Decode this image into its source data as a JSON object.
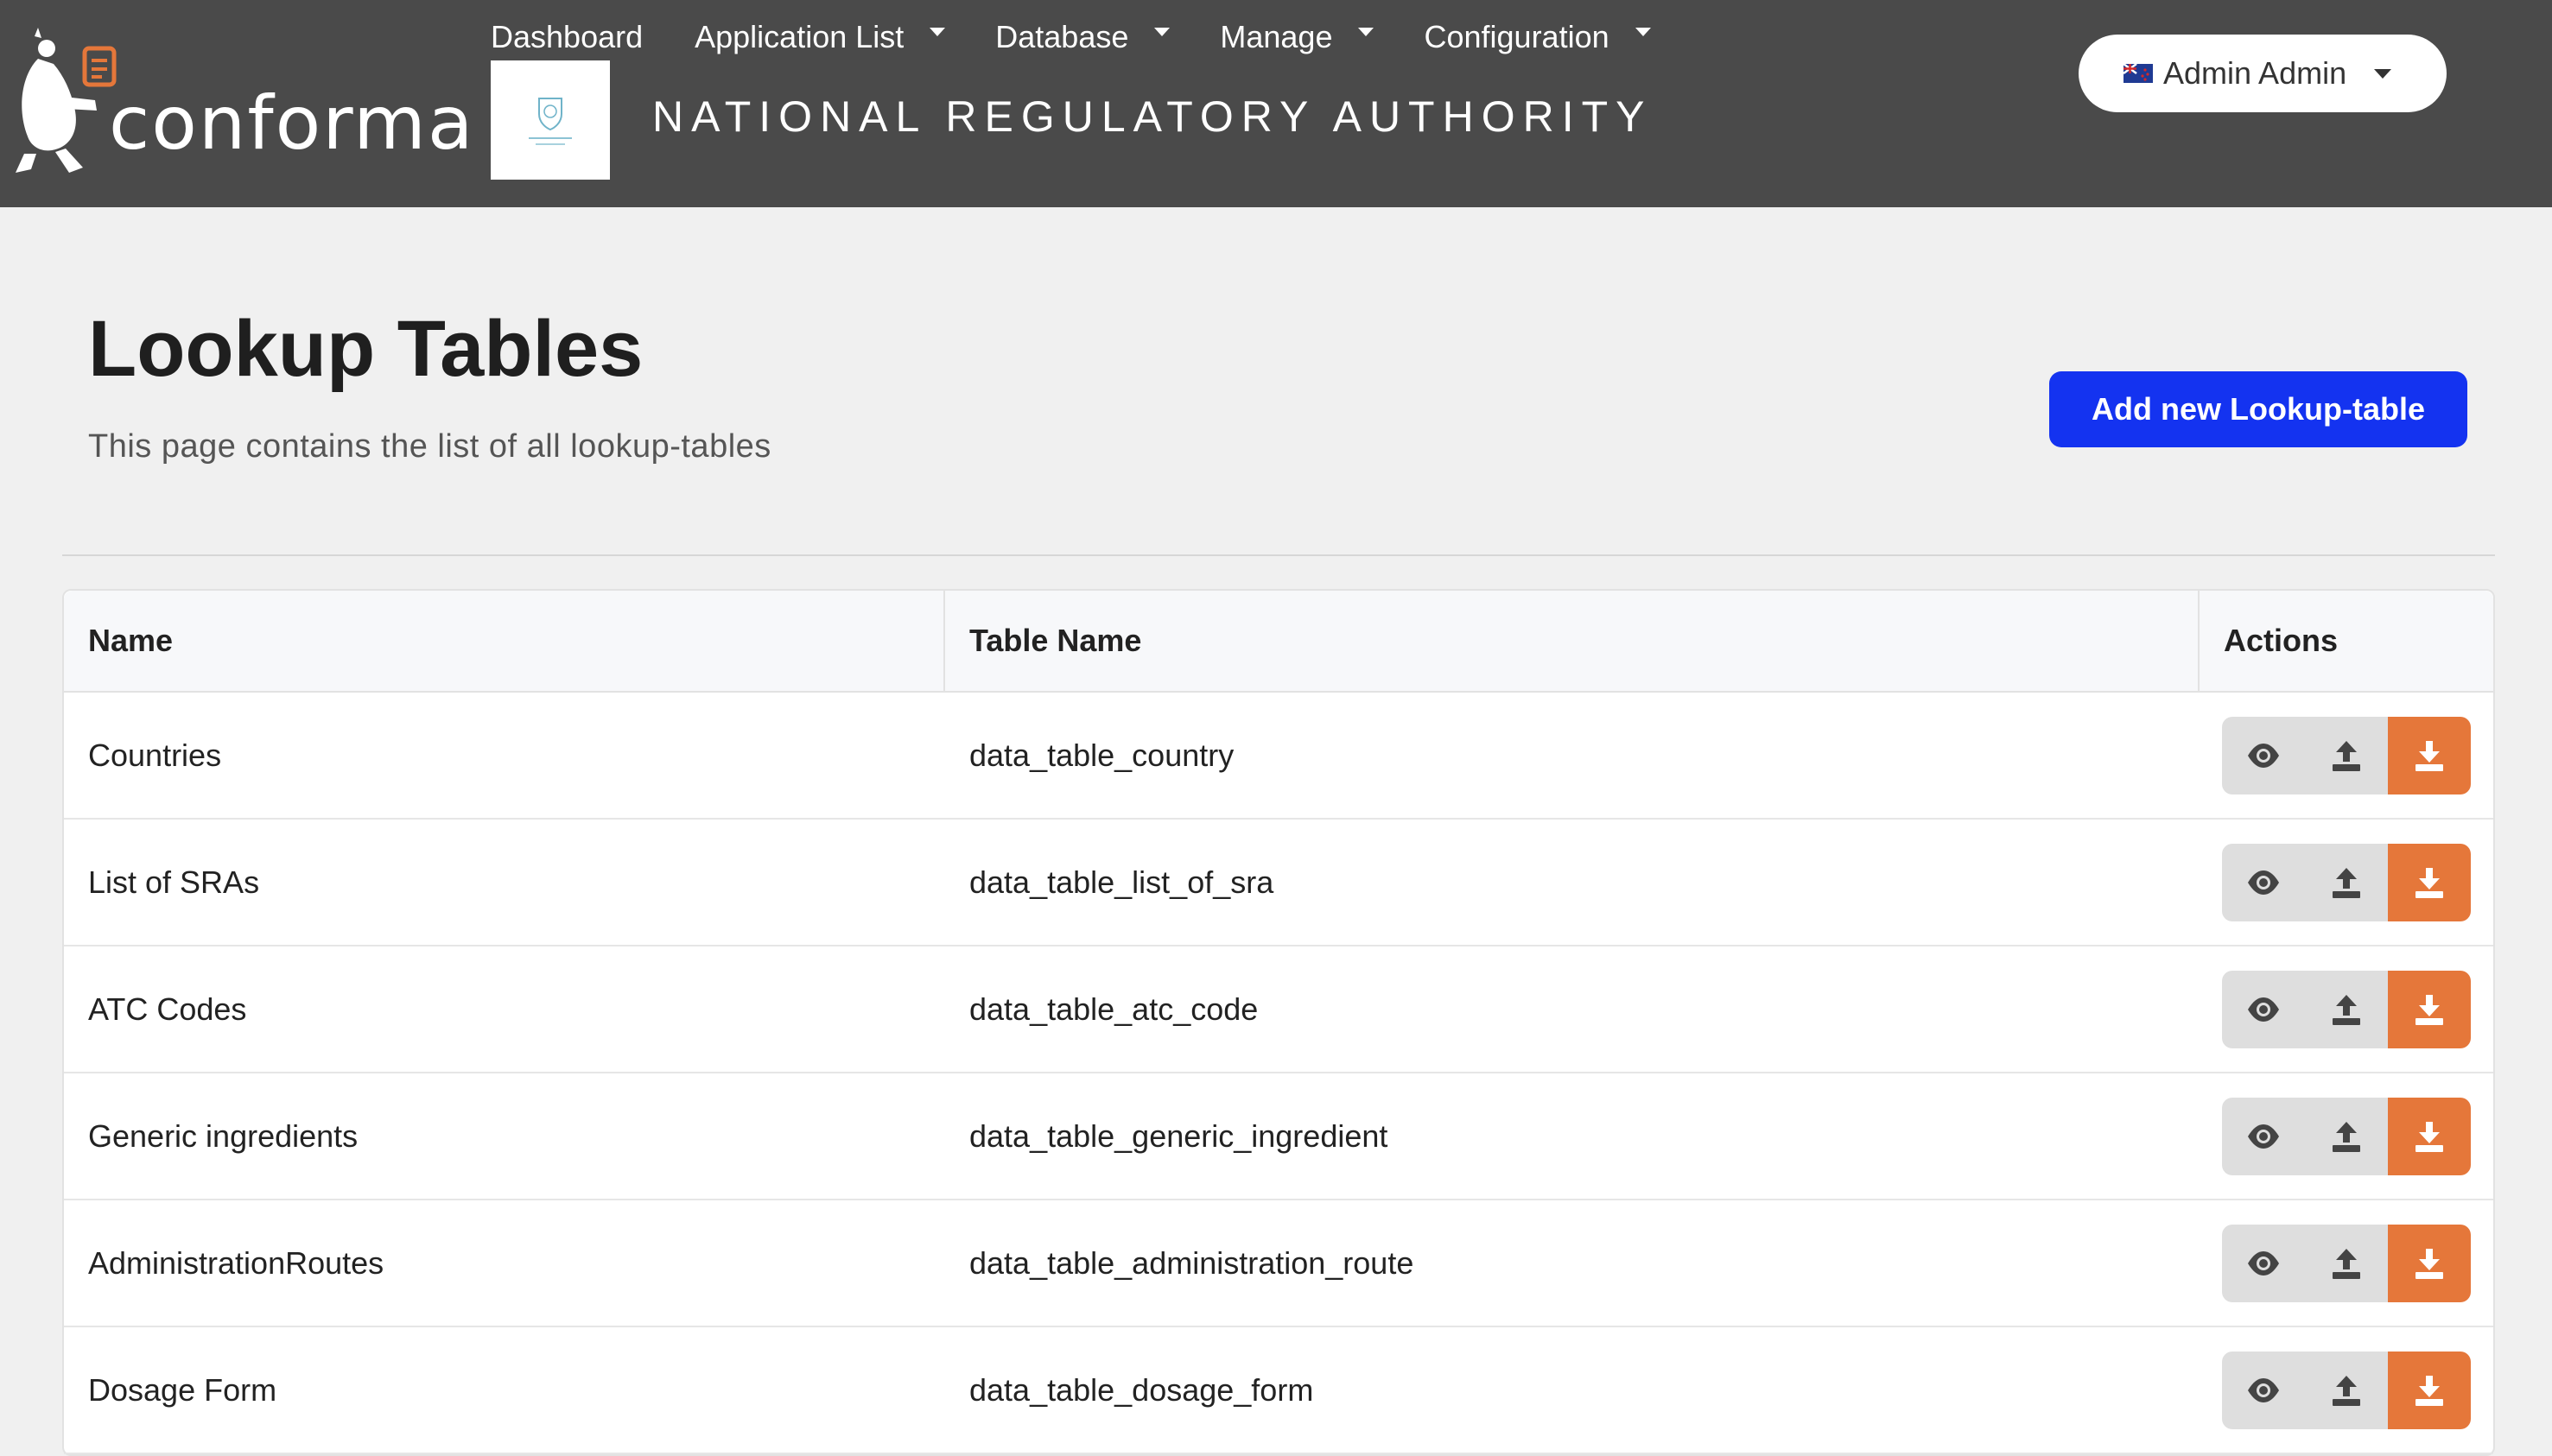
{
  "brand": {
    "app_name": "conforma",
    "org_name": "NATIONAL REGULATORY AUTHORITY"
  },
  "nav": {
    "items": [
      {
        "label": "Dashboard",
        "has_dropdown": false
      },
      {
        "label": "Application List",
        "has_dropdown": true
      },
      {
        "label": "Database",
        "has_dropdown": true
      },
      {
        "label": "Manage",
        "has_dropdown": true
      },
      {
        "label": "Configuration",
        "has_dropdown": true
      }
    ]
  },
  "user": {
    "name": "Admin Admin",
    "flag_icon": "flag-icon"
  },
  "page": {
    "title": "Lookup Tables",
    "subtitle": "This page contains the list of all lookup-tables",
    "add_button": "Add new Lookup-table"
  },
  "table": {
    "headers": {
      "name": "Name",
      "table_name": "Table Name",
      "actions": "Actions"
    },
    "rows": [
      {
        "name": "Countries",
        "table_name": "data_table_country"
      },
      {
        "name": "List of SRAs",
        "table_name": "data_table_list_of_sra"
      },
      {
        "name": "ATC Codes",
        "table_name": "data_table_atc_code"
      },
      {
        "name": "Generic ingredients",
        "table_name": "data_table_generic_ingredient"
      },
      {
        "name": "AdministrationRoutes",
        "table_name": "data_table_administration_route"
      },
      {
        "name": "Dosage Form",
        "table_name": "data_table_dosage_form"
      }
    ],
    "row_actions": [
      "eye-icon",
      "upload-icon",
      "download-icon"
    ]
  },
  "colors": {
    "topbar": "#4a4a4a",
    "primary": "#1433f0",
    "download_action": "#e5773a",
    "action_gray": "#dedede",
    "page_bg": "#f0f0f0"
  }
}
